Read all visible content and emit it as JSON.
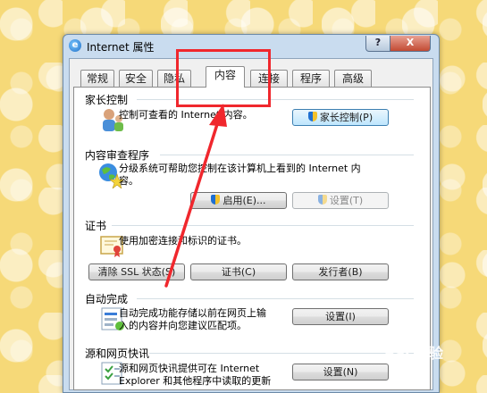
{
  "window": {
    "title": "Internet 属性",
    "help_label": "?",
    "close_label": "X"
  },
  "tabs": [
    {
      "label": "常规"
    },
    {
      "label": "安全"
    },
    {
      "label": "隐私"
    },
    {
      "label": "内容",
      "active": true
    },
    {
      "label": "连接"
    },
    {
      "label": "程序"
    },
    {
      "label": "高级"
    }
  ],
  "sections": {
    "parental": {
      "title": "家长控制",
      "desc": "控制可查看的 Internet 内容。",
      "button": "家长控制(P)",
      "icon": "parental-controls-icon"
    },
    "advisor": {
      "title": "内容审查程序",
      "desc_line1": "分级系统可帮助您控制在该计算机上看到的 Internet 内",
      "desc_line2": "容。",
      "enable_button": "启用(E)...",
      "settings_button": "设置(T)",
      "icon": "globe-star-icon"
    },
    "certificates": {
      "title": "证书",
      "desc": "使用加密连接和标识的证书。",
      "clear_ssl_button": "清除 SSL 状态(S)",
      "certificates_button": "证书(C)",
      "publishers_button": "发行者(B)",
      "icon": "certificate-icon"
    },
    "autocomplete": {
      "title": "自动完成",
      "desc_line1": "自动完成功能存储以前在网页上输",
      "desc_line2": "入的内容并向您建议匹配项。",
      "settings_button": "设置(I)",
      "icon": "autocomplete-icon"
    },
    "feeds": {
      "title": "源和网页快讯",
      "desc_line1": "源和网页快讯提供可在 Internet",
      "desc_line2": "Explorer 和其他程序中读取的更新",
      "settings_button": "设置(N)",
      "icon": "feeds-icon"
    }
  },
  "watermark": "Bai 经验",
  "colors": {
    "annotation": "#f0272d",
    "background": "#f6d978"
  }
}
